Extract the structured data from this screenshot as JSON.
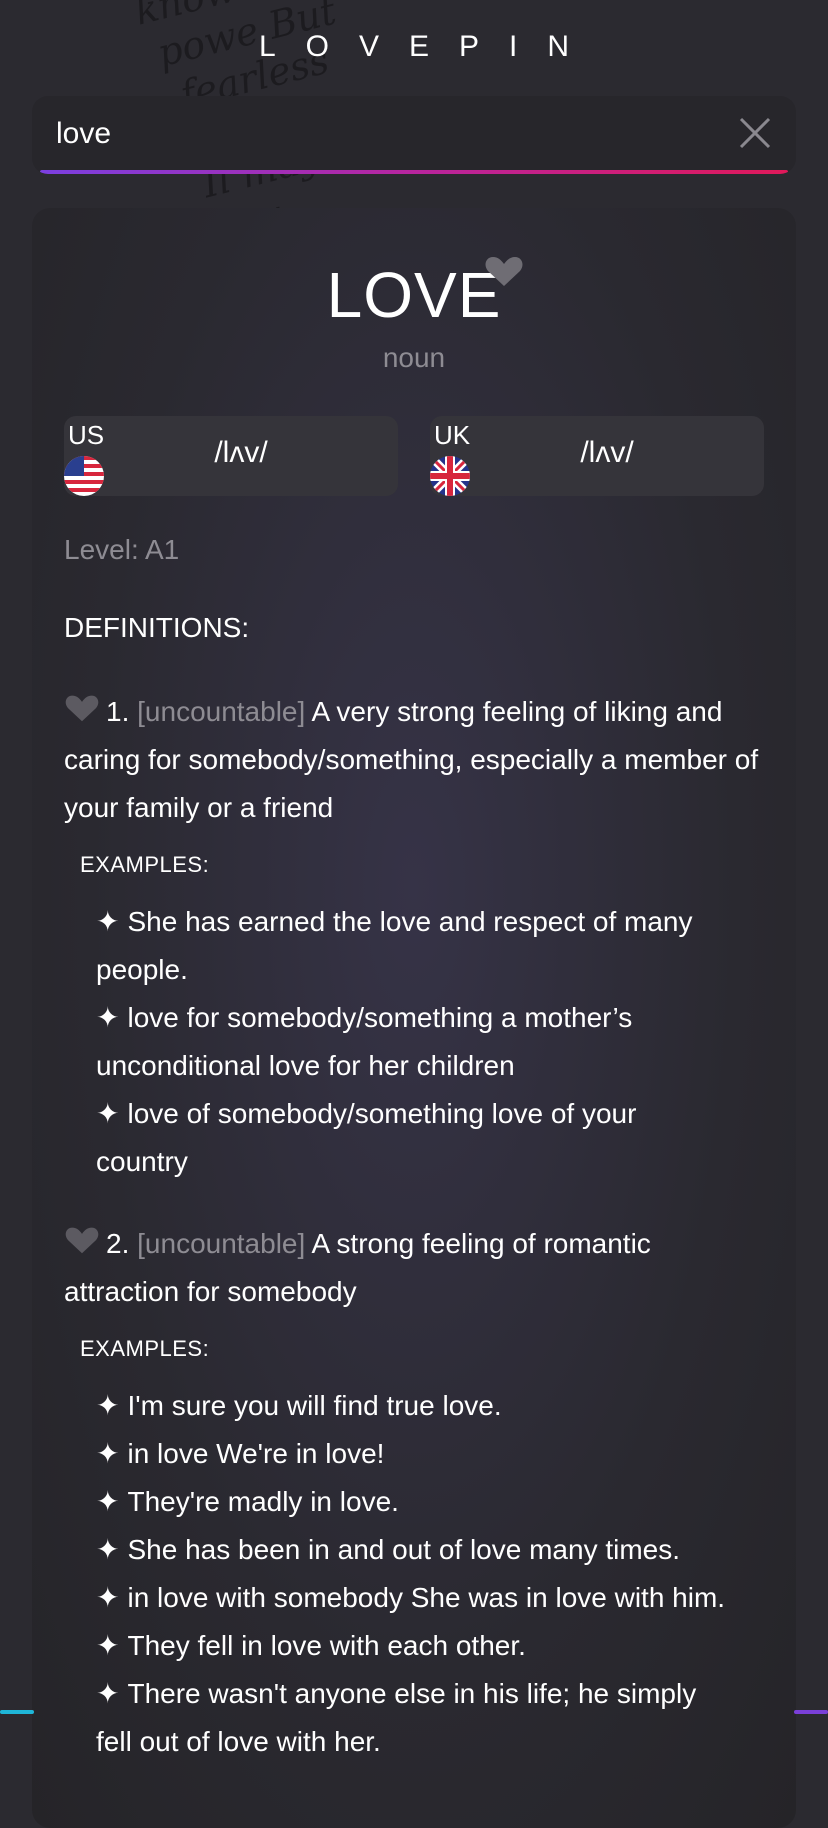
{
  "app": {
    "brand": "LOVEPIN"
  },
  "search": {
    "value": "love",
    "clear_icon": "close-icon"
  },
  "entry": {
    "word": "LOVE",
    "part_of_speech": "noun",
    "level": "Level: A1",
    "pronunciations": [
      {
        "label": "US",
        "ipa": "/lʌv/",
        "flag_icon": "us-flag-icon"
      },
      {
        "label": "UK",
        "ipa": "/lʌv/",
        "flag_icon": "uk-flag-icon"
      }
    ],
    "definitions_title": "DEFINITIONS:",
    "definitions": [
      {
        "number": "1.",
        "tag": "[uncountable]",
        "text": "A very strong feeling of liking and caring for somebody/something, especially a member of your family or a friend",
        "examples_title": "EXAMPLES:",
        "examples": [
          "She has earned the love and respect of many people.",
          "love for somebody/something a mother’s unconditional love for her children",
          "love of somebody/something love of your country"
        ]
      },
      {
        "number": "2.",
        "tag": "[uncountable]",
        "text": "A strong feeling of romantic attraction for somebody",
        "examples_title": "EXAMPLES:",
        "examples": [
          "I'm sure you will find true love.",
          "in love We're in love!",
          "They're madly in love.",
          "She has been in and out of love many times.",
          "in love with somebody She was in love with him.",
          "They fell in love with each other.",
          "There wasn't anyone else in his life; he simply fell out of love with her."
        ]
      }
    ]
  },
  "icons": {
    "heart": "heart-icon",
    "bullet": "✦"
  },
  "colors": {
    "accent_start": "#7b3fe0",
    "accent_end": "#e0195a",
    "muted": "#8e8c93"
  }
}
